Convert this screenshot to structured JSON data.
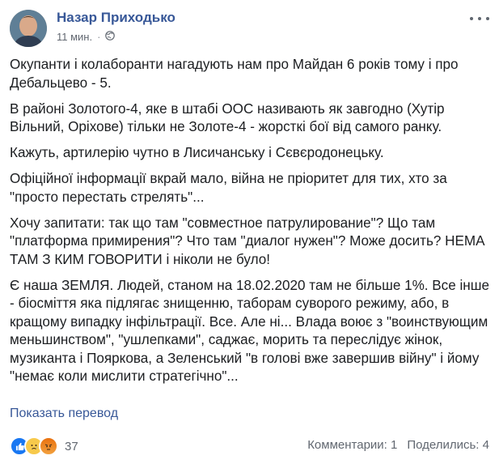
{
  "post": {
    "author": "Назар Приходько",
    "time": "11 мин.",
    "privacy_icon": "globe-icon",
    "paragraphs": [
      "Окупанти і колаборанти нагадують нам про Майдан 6 років тому і про Дебальцево - 5.",
      "В районі Золотого-4, яке в штабі ООС називають як завгодно (Хутір Вільний, Оріхове) тільки не Золоте-4 - жорсткі бої від самого ранку.",
      "Кажуть, артилерію чутно в Лисичанську і Сєвєродонецьку.",
      "Офіційної інформації вкрай мало, війна не пріоритет для тих, хто за \"просто перестать стрелять\"...",
      "Хочу запитати: так що там \"совместное патрулирование\"? Що там \"платформа примирения\"? Что там \"диалог нужен\"? Може досить? НЕМА ТАМ З КИМ ГОВОРИТИ і ніколи не було!",
      "Є наша ЗЕМЛЯ. Людей, станом на 18.02.2020 там не більше 1%. Все інше - біосміття яка підлягає знищенню, таборам суворого режиму, або, в кращому випадку інфільтрації. Все. Але ні... Влада воює з \"воинствующим меньшинством\", \"ушлепками\", саджає, морить та переслідує жінок, музиканта і Пояркова, а Зеленський \"в голові вже завершив війну\" і йому \"немає коли мислити стратегічно\"..."
    ],
    "translate_label": "Показать перевод"
  },
  "footer": {
    "reaction_icons": [
      "like-icon",
      "sad-icon",
      "angry-icon"
    ],
    "reaction_count": "37",
    "comments": "Комментарии: 1",
    "shares": "Поделились: 4"
  },
  "colors": {
    "link": "#385898",
    "text": "#1c1e21",
    "meta": "#616770",
    "like": "#1877f2"
  }
}
